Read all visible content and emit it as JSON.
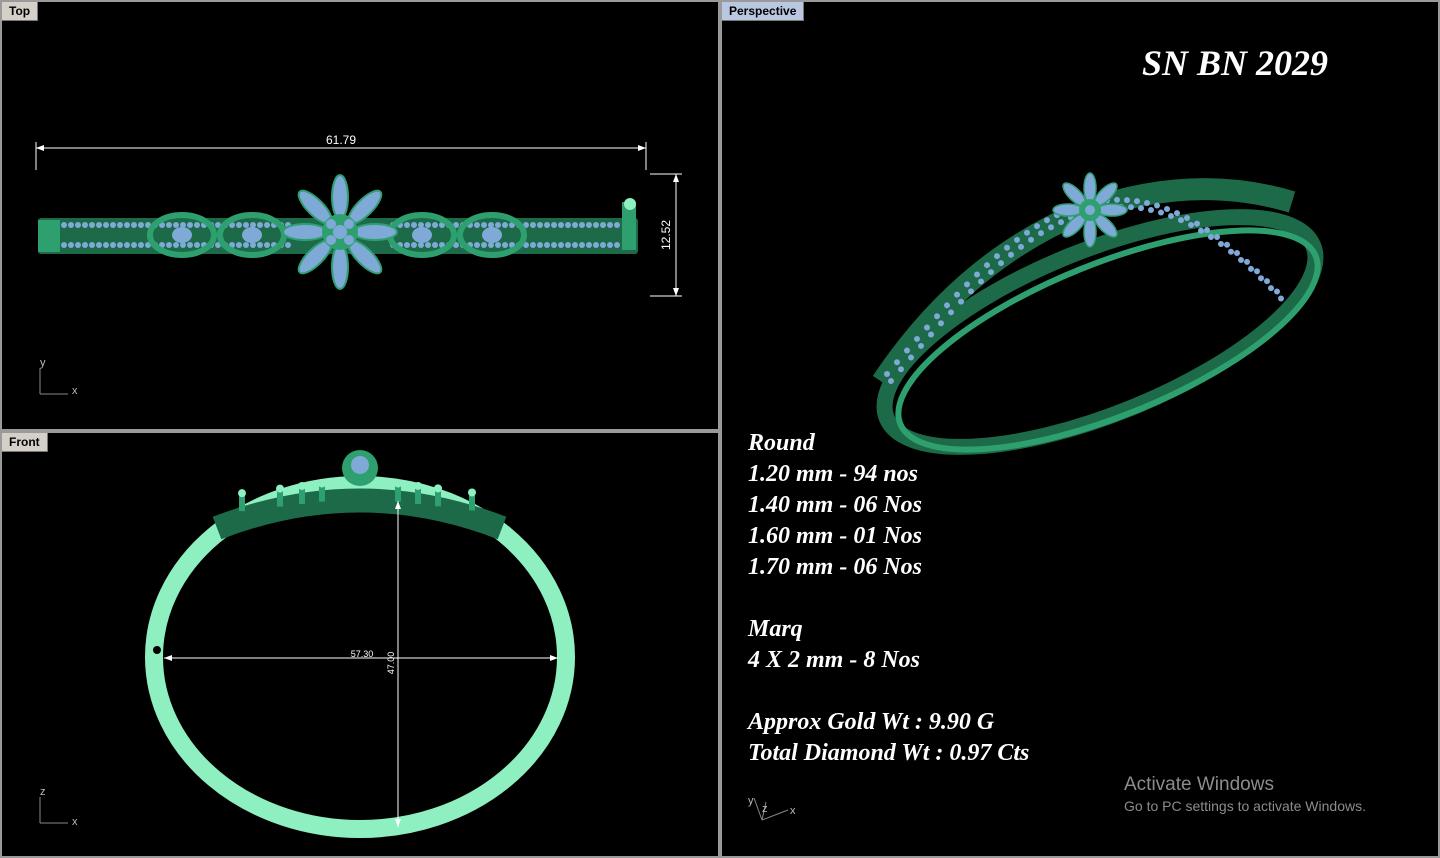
{
  "viewports": {
    "top": {
      "label": "Top",
      "width_dim": "61.79",
      "height_dim": "12.52",
      "axis_v": "y",
      "axis_h": "x"
    },
    "front": {
      "label": "Front",
      "width_dim": "57.30",
      "height_dim": "47.00",
      "axis_v": "z",
      "axis_h": "x"
    },
    "perspective": {
      "label": "Perspective",
      "axis_labels": [
        "y",
        "z",
        "x"
      ]
    }
  },
  "design": {
    "title": "SN BN 2029",
    "specs": [
      "Round",
      "1.20 mm - 94 nos",
      "1.40 mm - 06 Nos",
      "1.60 mm - 01 Nos",
      "1.70 mm - 06 Nos",
      "",
      "Marq",
      "4 X 2 mm - 8 Nos",
      "",
      "Approx Gold Wt : 9.90 G",
      "Total Diamond Wt : 0.97 Cts"
    ]
  },
  "watermark": {
    "line1": "Activate Windows",
    "line2": "Go to PC settings to activate Windows."
  },
  "colors": {
    "metal": "#2ea070",
    "metal_light": "#8ef0c0",
    "stone": "#7fa9d6",
    "viewport_bg": "#000000",
    "active_tab": "#b9c7e0"
  }
}
